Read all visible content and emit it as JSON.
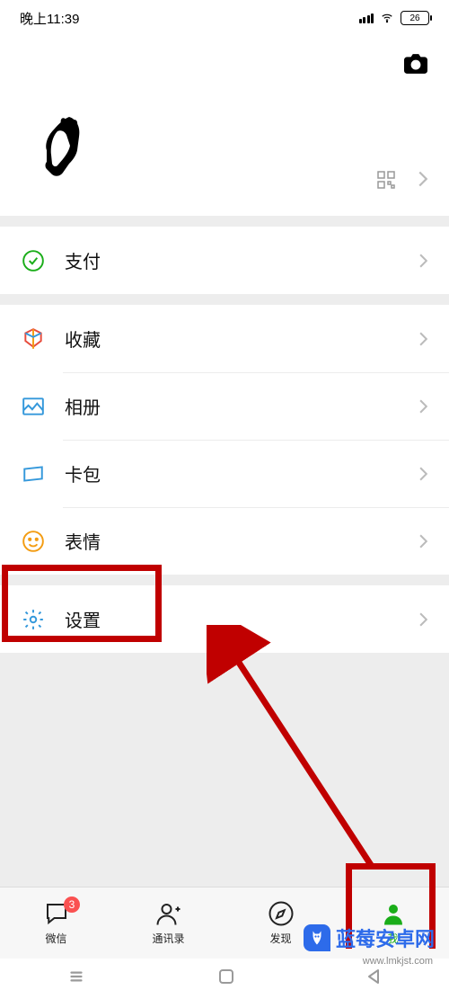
{
  "status": {
    "time": "晚上11:39",
    "battery": "26"
  },
  "menu": {
    "pay": "支付",
    "fav": "收藏",
    "album": "相册",
    "cards": "卡包",
    "sticker": "表情",
    "settings": "设置"
  },
  "tabs": {
    "chat": {
      "label": "微信",
      "badge": "3"
    },
    "contacts": {
      "label": "通讯录"
    },
    "discover": {
      "label": "发现"
    },
    "me": {
      "label": "我"
    }
  },
  "watermark": {
    "text": "蓝莓安卓网",
    "url": "www.lmkjst.com"
  }
}
